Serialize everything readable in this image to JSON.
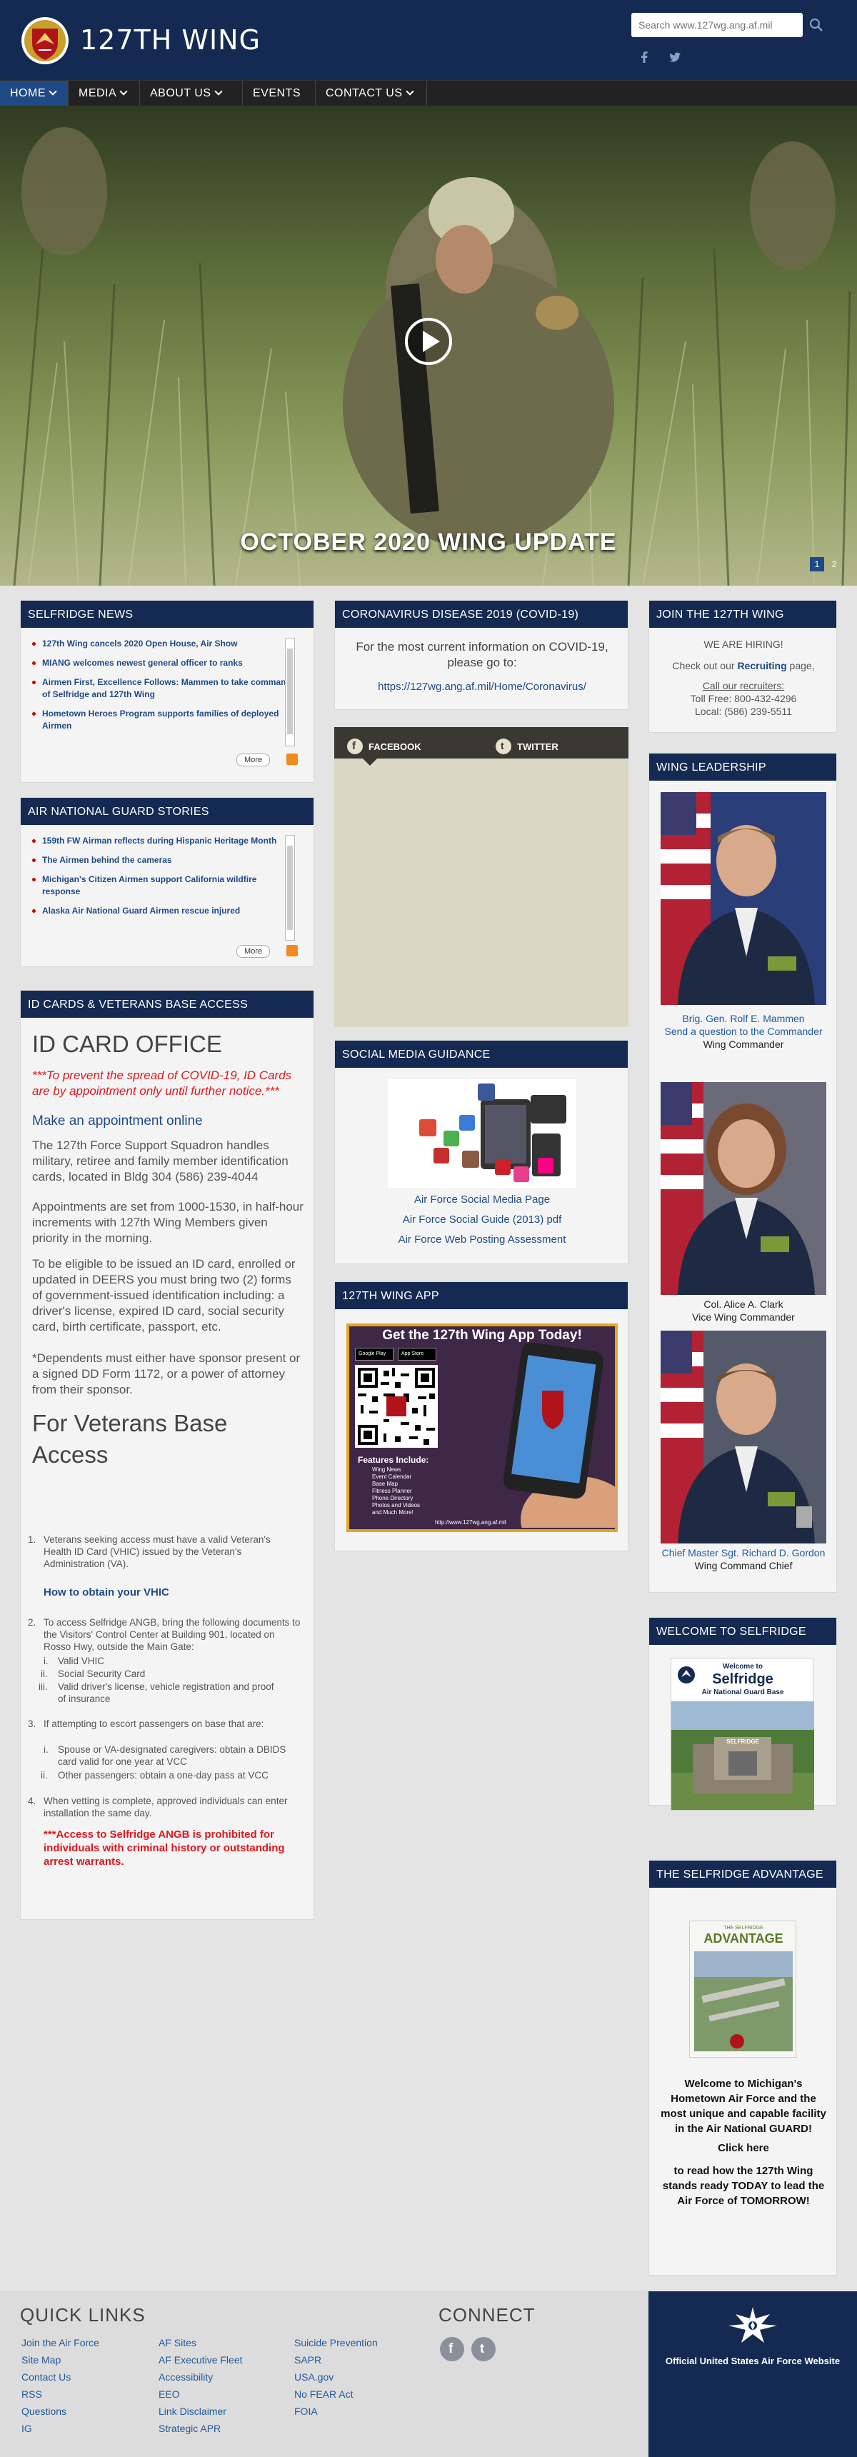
{
  "header": {
    "site_title": "127TH WING",
    "search_placeholder": "Search www.127wg.ang.af.mil"
  },
  "nav": {
    "items": [
      {
        "label": "HOME"
      },
      {
        "label": "MEDIA"
      },
      {
        "label": "ABOUT US"
      },
      {
        "label": "EVENTS"
      },
      {
        "label": "CONTACT US"
      }
    ]
  },
  "hero": {
    "caption": "OCTOBER 2020 WING UPDATE",
    "pages": [
      "1",
      "2"
    ]
  },
  "selfridge_news": {
    "title": "SELFRIDGE NEWS",
    "items": [
      "127th Wing cancels 2020 Open House, Air Show",
      "MIANG welcomes newest general officer to ranks",
      "Airmen First, Excellence Follows: Mammen to take command of Selfridge and 127th Wing",
      "Hometown Heroes Program supports families of deployed Airmen"
    ],
    "more": "More"
  },
  "ang_stories": {
    "title": "AIR NATIONAL GUARD STORIES",
    "items": [
      "159th FW Airman reflects during Hispanic Heritage Month",
      "The Airmen behind the cameras",
      "Michigan's Citizen Airmen support California wildfire response",
      "Alaska Air National Guard Airmen rescue injured"
    ],
    "more": "More"
  },
  "id_cards": {
    "title": "ID CARDS & VETERANS BASE ACCESS",
    "heading": "ID CARD OFFICE",
    "warning": "***To prevent the spread of COVID-19, ID Cards are by appointment only until further notice.***",
    "appointment_link": "Make an appointment online",
    "p1": "The 127th Force Support Squadron handles military, retiree and family member identification cards, located in Bldg 304 (586) 239-4044",
    "p2": "Appointments are set from 1000-1530, in half-hour increments with 127th Wing Members given priority in the morning.",
    "p3": "To be eligible to be issued an ID card, enrolled or updated in DEERS you must bring two (2) forms of government-issued identification including: a driver's license, expired ID card, social security card, birth certificate, passport, etc.",
    "p4": "*Dependents must either have sponsor present or a signed DD Form 1172, or a power of attorney from their sponsor.",
    "veterans_heading": "For Veterans Base Access",
    "li1": "Veterans seeking access must have a valid Veteran's Health ID Card (VHIC) issued by the Veteran's Administration (VA).",
    "vhic_link": "How to obtain your VHIC",
    "li2": "To access Selfridge ANGB, bring the following documents to the Visitors' Control Center at Building 901, located on Rosso Hwy, outside the Main Gate:",
    "li2_sub": [
      "Valid VHIC",
      "Social Security Card",
      "Valid driver's license, vehicle registration and proof of insurance"
    ],
    "li3": "If attempting to escort passengers on base that are:",
    "li3_sub": [
      "Spouse or VA-designated caregivers: obtain a DBIDS card valid for one year at VCC",
      "Other passengers: obtain a one-day pass at VCC"
    ],
    "li4": "When vetting is complete, approved individuals can enter installation the same day.",
    "prohibited": "***Access to Selfridge ANGB is prohibited for individuals with criminal history or outstanding arrest warrants."
  },
  "covid": {
    "title": "CORONAVIRUS DISEASE 2019 (COVID-19)",
    "text": "For the most current information on COVID-19, please go to:",
    "link": "https://127wg.ang.af.mil/Home/Coronavirus/"
  },
  "social_tabs": {
    "facebook": "FACEBOOK",
    "twitter": "TWITTER"
  },
  "social_guidance": {
    "title": "SOCIAL MEDIA GUIDANCE",
    "links": [
      "Air Force Social Media Page",
      "Air Force Social Guide (2013) pdf",
      "Air Force Web Posting Assessment"
    ]
  },
  "wing_app": {
    "title": "127TH WING APP",
    "banner": "Get the 127th Wing App Today!",
    "features_title": "Features Include:",
    "features": [
      "Wing News",
      "Event Calendar",
      "Base Map",
      "Fitness Planner",
      "Phone Directory",
      "Photos and Videos",
      "and Much More!"
    ],
    "url": "http://www.127wg.ang.af.mil",
    "google_play": "Google Play",
    "app_store": "App Store"
  },
  "join": {
    "title": "JOIN THE 127TH WING",
    "hiring": "WE ARE HIRING!",
    "check_prefix": "Check out our ",
    "recruiting": "Recruiting",
    "check_suffix": " page,",
    "call": "Call our recruiters",
    "toll_free": "Toll Free: 800-432-4296",
    "local": "Local: (586) 239-5511"
  },
  "leadership": {
    "title": "WING LEADERSHIP",
    "leaders": [
      {
        "name": "Brig. Gen. Rolf E. Mammen",
        "extra": "Send a question to the Commander",
        "role": "Wing Commander"
      },
      {
        "name": "Col. Alice A. Clark",
        "role": "Vice Wing Commander"
      },
      {
        "name": "Chief Master Sgt. Richard D. Gordon",
        "role": "Wing Command Chief"
      }
    ]
  },
  "welcome": {
    "title": "WELCOME TO SELFRIDGE",
    "card_line1": "Welcome to",
    "card_line2": "Selfridge",
    "card_line3": "Air National Guard Base",
    "sign_text": "SELFRIDGE"
  },
  "advantage": {
    "title": "THE SELFRIDGE ADVANTAGE",
    "cover_title": "ADVANTAGE",
    "cover_sub": "THE SELFRIDGE",
    "text1": "Welcome to Michigan's Hometown Air Force and the most unique and capable facility in the Air National GUARD!",
    "click": "Click here",
    "text2": "to read how the 127th Wing stands ready TODAY to lead the Air Force of TOMORROW!"
  },
  "footer": {
    "quick_links_title": "QUICK LINKS",
    "connect_title": "CONNECT",
    "col1": [
      "Join the Air Force",
      "Site Map",
      "Contact Us",
      "RSS",
      "Questions",
      "IG"
    ],
    "col2": [
      "AF Sites",
      "AF Executive Fleet",
      "Accessibility",
      "EEO",
      "Link Disclaimer",
      "Strategic APR"
    ],
    "col3": [
      "Suicide Prevention",
      "SAPR",
      "USA.gov",
      "No FEAR Act",
      "FOIA"
    ],
    "official": "Official United States Air Force Website"
  },
  "colors": {
    "navy": "#142a52",
    "link": "#1f5a9c",
    "red": "#e0171f"
  }
}
